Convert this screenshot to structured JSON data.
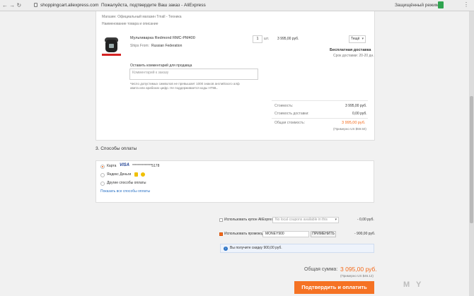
{
  "browser": {
    "url": "shoppingcart.aliexpress.com",
    "tab_title": "Пожалуйста, подтвердите Ваш заказ - AliExpress",
    "protected_mode": "Защищённый режим"
  },
  "order": {
    "store": "Магазин: Официальный магазин Tmall - Техника",
    "columns_header": "Наименование товара и описание",
    "product_name": "Мультиварка Redmond RMC-PM400",
    "ships_from_label": "Ships From:",
    "ships_from_value": "Russian Federation",
    "qty": "1",
    "unit": "шт.",
    "price": "3 995,00 руб.",
    "shipping_select": "Тещё",
    "free_delivery": "Бесплатная доставка",
    "delivery_time": "Срок доставки: 20-20 дн.",
    "comment_label": "Оставить комментарий для продавца",
    "comment_placeholder": "Комментарий к заказу",
    "comment_hint_1": "Число допустимых символов не превышает 1000 знаков английского алф",
    "comment_hint_2": "авита или арабских цифр. Не поддерживается коды HTML.",
    "cost_label": "Стоимость:",
    "cost_value": "3 995,00 руб.",
    "delivery_label": "Стоимость доставки:",
    "delivery_value": "0,00 руб.",
    "total_label": "Общая стоимость:",
    "total_value": "3 995,00 руб.",
    "total_usd": "(Примерно US $59.50)"
  },
  "payment": {
    "section_title": "3. Способы оплаты",
    "card_label": "Карта",
    "card_brand": "VISA",
    "card_number": "**************5178",
    "yandex": "Яндекс Деньги",
    "other": "Другие способы оплаты",
    "show_all": "Показать все способы оплаты"
  },
  "coupons": {
    "coupon_label": "Использовать купон AliExpress:",
    "coupon_placeholder": "No local coupons available in this",
    "coupon_value": "- 0,00 руб.",
    "promo_label": "Использовать промокод:",
    "promo_code": "MONEY900",
    "apply_button": "ПРИМЕНИТЬ",
    "promo_value": "- 900,00 руб.",
    "saving_note": "Вы получите скидку 900,00 руб."
  },
  "summary": {
    "total_label": "Общая сумма:",
    "total_value": "3 095,00 руб.",
    "total_usd": "(Примерно US $46.12)",
    "confirm_button": "Подтвердить и оплатить",
    "watermark": "M Y"
  }
}
